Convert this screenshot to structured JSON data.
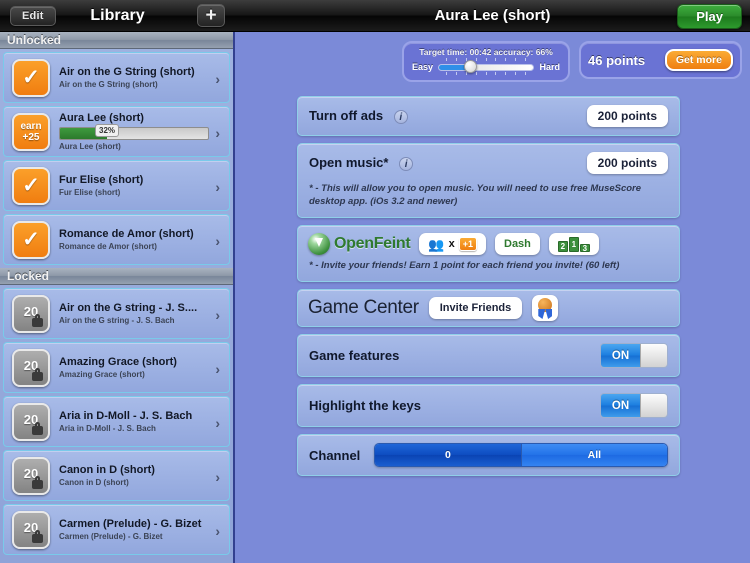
{
  "navbar": {
    "edit_label": "Edit",
    "library_title": "Library",
    "add_label": "+",
    "song_title": "Aura Lee (short)",
    "play_label": "Play"
  },
  "sidebar": {
    "sections": [
      {
        "header": "Unlocked",
        "items": [
          {
            "icon": "check-icon",
            "badge": "",
            "title": "Air on the G String (short)",
            "subtitle": "Air on the G String (short)",
            "progress": null,
            "chevron": "›"
          },
          {
            "icon": "earn-icon",
            "badge": "earn +25",
            "badge_line1": "earn",
            "badge_line2": "+25",
            "title": "Aura Lee (short)",
            "subtitle": "Aura Lee (short)",
            "progress": 32,
            "progress_label": "32%",
            "chevron": "›"
          },
          {
            "icon": "check-icon",
            "badge": "",
            "title": "Fur Elise (short)",
            "subtitle": "Fur Elise (short)",
            "progress": null,
            "chevron": "›"
          },
          {
            "icon": "check-icon",
            "badge": "",
            "title": "Romance de Amor (short)",
            "subtitle": "Romance de Amor (short)",
            "progress": null,
            "chevron": "›"
          }
        ]
      },
      {
        "header": "Locked",
        "items": [
          {
            "icon": "lock-icon",
            "badge": "20",
            "title": "Air on the G string - J. S....",
            "subtitle": "Air on the G string - J. S. Bach",
            "progress": null,
            "chevron": "›"
          },
          {
            "icon": "lock-icon",
            "badge": "20",
            "title": "Amazing Grace (short)",
            "subtitle": "Amazing Grace (short)",
            "progress": null,
            "chevron": "›"
          },
          {
            "icon": "lock-icon",
            "badge": "20",
            "title": "Aria in D-Moll - J. S. Bach",
            "subtitle": "Aria in D-Moll - J. S. Bach",
            "progress": null,
            "chevron": "›"
          },
          {
            "icon": "lock-icon",
            "badge": "20",
            "title": "Canon in D (short)",
            "subtitle": "Canon in D (short)",
            "progress": null,
            "chevron": "›"
          },
          {
            "icon": "lock-icon",
            "badge": "20",
            "title": "Carmen (Prelude) - G. Bizet",
            "subtitle": "Carmen (Prelude) - G. Bizet",
            "progress": null,
            "chevron": "›"
          }
        ]
      }
    ]
  },
  "difficulty_widget": {
    "status": "Target time: 00:42 accuracy: 66%",
    "easy_label": "Easy",
    "hard_label": "Hard",
    "value_percent": 34
  },
  "points_widget": {
    "points_label": "46 points",
    "get_more_label": "Get more"
  },
  "settings": {
    "turn_off_ads": {
      "label": "Turn off ads",
      "info": "i",
      "price": "200 points"
    },
    "open_music": {
      "label": "Open music*",
      "info": "i",
      "price": "200 points",
      "note": "* - This will allow you to open music. You will need to use free MuseScore desktop app. (iOs 3.2 and newer)"
    },
    "openfeint": {
      "brand": "OpenFeint",
      "friends_x": "x",
      "friends_badge": "+1",
      "dash_label": "Dash",
      "podium": {
        "second": "2",
        "first": "1",
        "third": "3"
      },
      "note": "* - Invite your friends! Earn 1 point for each friend you invite! (60 left)"
    },
    "game_center": {
      "title": "Game Center",
      "invite_label": "Invite Friends",
      "achievements_icon": "medal-icon"
    },
    "game_features": {
      "label": "Game features",
      "state": "ON"
    },
    "highlight_keys": {
      "label": "Highlight the keys",
      "state": "ON"
    },
    "channel": {
      "label": "Channel",
      "options": [
        "0",
        "All"
      ],
      "selected": "0"
    }
  },
  "colors": {
    "accent_orange": "#f08010",
    "accent_green": "#2a8a2a",
    "toggle_blue": "#1d7fe0",
    "panel_blue": "#7b8ad8"
  }
}
